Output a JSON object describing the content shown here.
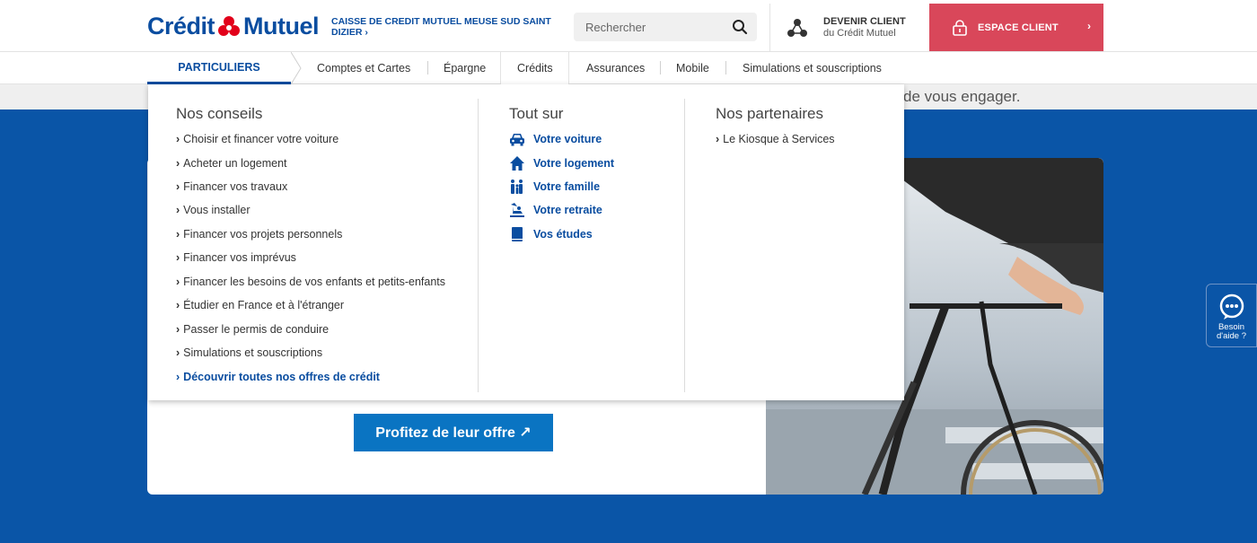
{
  "header": {
    "logo_left": "Crédit",
    "logo_right": "Mutuel",
    "caisse": "CAISSE DE CREDIT MUTUEL MEUSE SUD SAINT DIZIER",
    "caisse_chevron": "›",
    "search_placeholder": "Rechercher",
    "devenir_title": "DEVENIR CLIENT",
    "devenir_sub": "du Crédit Mutuel",
    "espace_label": "ESPACE CLIENT",
    "espace_chevron": "›"
  },
  "nav": {
    "particuliers": "PARTICULIERS",
    "items": [
      "Comptes et Cartes",
      "Épargne",
      "Crédits",
      "Assurances",
      "Mobile",
      "Simulations et souscriptions"
    ]
  },
  "background": {
    "band_text": "de vous engager.",
    "cta_label": "Profitez de leur offre ↗",
    "help_label_1": "Besoin",
    "help_label_2": "d'aide ?"
  },
  "mega": {
    "conseils_title": "Nos conseils",
    "conseils": [
      "Choisir et financer votre voiture",
      "Acheter un logement",
      "Financer vos travaux",
      "Vous installer",
      "Financer vos projets personnels",
      "Financer vos imprévus",
      "Financer les besoins de vos enfants et petits-enfants",
      "Étudier en France et à l'étranger",
      "Passer le permis de conduire",
      "Simulations et souscriptions"
    ],
    "conseils_all": "Découvrir toutes nos offres de crédit",
    "toutsur_title": "Tout sur",
    "toutsur": [
      {
        "label": "Votre voiture",
        "icon": "car-icon"
      },
      {
        "label": "Votre logement",
        "icon": "house-icon"
      },
      {
        "label": "Votre famille",
        "icon": "family-icon"
      },
      {
        "label": "Votre retraite",
        "icon": "retirement-icon"
      },
      {
        "label": "Vos études",
        "icon": "book-icon"
      }
    ],
    "partenaires_title": "Nos partenaires",
    "partenaires": [
      "Le Kiosque à Services"
    ],
    "chevron": "›"
  },
  "colors": {
    "brand_blue": "#0a4da0",
    "hero_blue": "#0a55a7",
    "espace_red": "#d9475a",
    "cta_blue": "#0a74c2"
  }
}
